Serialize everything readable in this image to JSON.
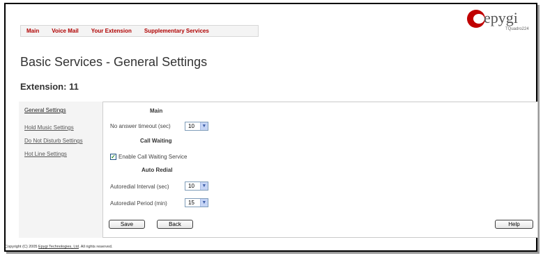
{
  "nav": {
    "items": [
      "Main",
      "Voice Mail",
      "Your Extension",
      "Supplementary Services"
    ]
  },
  "logo": {
    "brand": "epygi",
    "model": "TQuadro224",
    "icon": "epygi-swirl-logo",
    "brand_color": "#c00000"
  },
  "page": {
    "title": "Basic Services - General Settings",
    "subtitle": "Extension: 11"
  },
  "sidebar": {
    "items": [
      "General Settings",
      "Hold Music Settings",
      "Do Not Disturb Settings",
      "Hot Line Settings"
    ]
  },
  "form": {
    "main_title": "Main",
    "no_answer_label": "No answer timeout (sec)",
    "no_answer_value": "10",
    "call_waiting_title": "Call Waiting",
    "call_waiting_checkbox_label": "Enable Call Waiting Service",
    "call_waiting_checked": true,
    "auto_redial_title": "Auto Redial",
    "redial_interval_label": "Autoredial Interval (sec)",
    "redial_interval_value": "10",
    "redial_period_label": "Autoredial Period (min)",
    "redial_period_value": "15"
  },
  "buttons": {
    "save": "Save",
    "back": "Back",
    "help": "Help"
  },
  "footer": {
    "prefix": "Copyright (C) 2005 ",
    "link": "Epygi Technologies, Ltd",
    "suffix": ". All rights reserved."
  }
}
